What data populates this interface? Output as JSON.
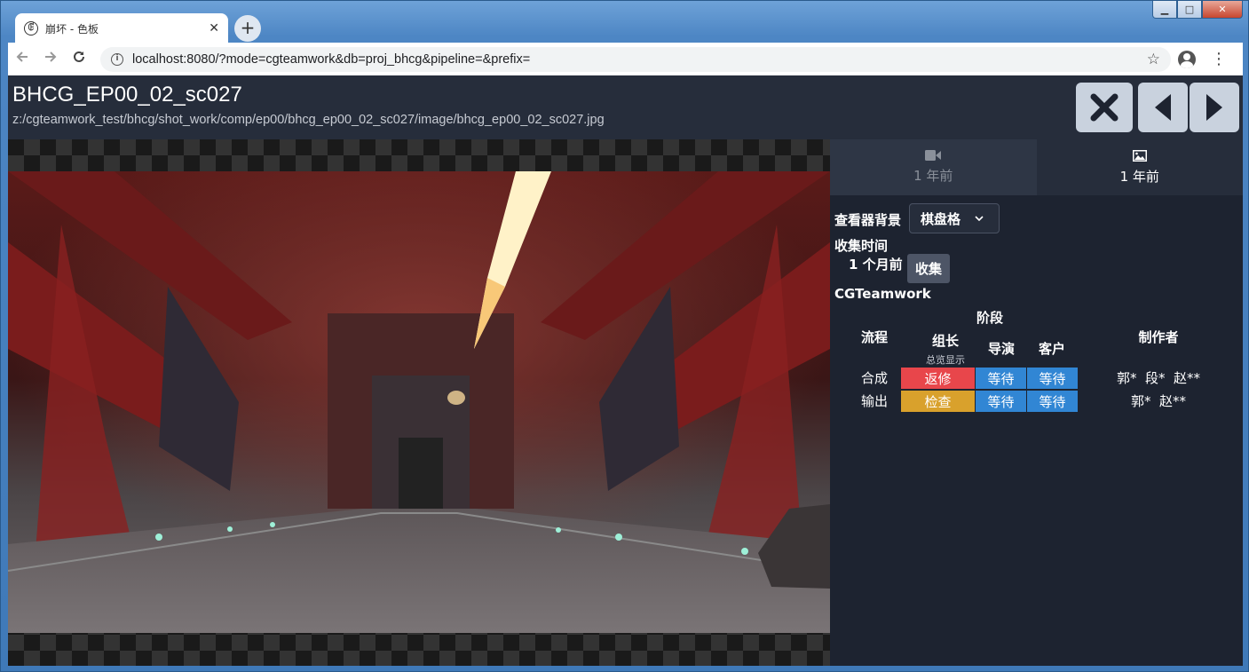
{
  "window": {
    "controls": {
      "minimize": "▁",
      "maximize": "□",
      "close": "✕"
    }
  },
  "browser": {
    "tab_title": "崩坏 - 色板",
    "tab_favicon": "ꂅ",
    "tab_close": "✕",
    "new_tab": "+",
    "url": "localhost:8080/?mode=cgteamwork&db=proj_bhcg&pipeline=&prefix=",
    "icons": {
      "back": "arrow-left-icon",
      "forward": "arrow-right-icon",
      "reload": "reload-icon",
      "info": "info-icon",
      "star": "star-icon",
      "profile": "avatar-icon",
      "menu": "kebab-menu-icon"
    }
  },
  "header": {
    "title": "BHCG_EP00_02_sc027",
    "path": "z:/cgteamwork_test/bhcg/shot_work/comp/ep00/bhcg_ep00_02_sc027/image/bhcg_ep00_02_sc027.jpg"
  },
  "media_tabs": [
    {
      "icon": "video-camera-icon",
      "label": "1 年前",
      "active": false
    },
    {
      "icon": "image-icon",
      "label": "1 年前",
      "active": true
    }
  ],
  "viewer_background": {
    "label": "查看器背景",
    "value": "棋盘格"
  },
  "collect": {
    "label": "收集时间",
    "time": "1 个月前",
    "button": "收集"
  },
  "cgteamwork": {
    "title": "CGTeamwork",
    "stage_header": "阶段",
    "col_pipeline": "流程",
    "col_leader": "组长",
    "col_leader_sub": "总览显示",
    "col_director": "导演",
    "col_client": "客户",
    "col_artist": "制作者",
    "rows": [
      {
        "pipeline": "合成",
        "leader": "返修",
        "leader_color": "#e8464b",
        "director": "等待",
        "client": "等待",
        "artists": "郭*  段*  赵**"
      },
      {
        "pipeline": "输出",
        "leader": "检查",
        "leader_color": "#d9a12c",
        "director": "等待",
        "client": "等待",
        "artists": "郭*  赵**"
      }
    ],
    "wait_color": "#3186d4"
  }
}
